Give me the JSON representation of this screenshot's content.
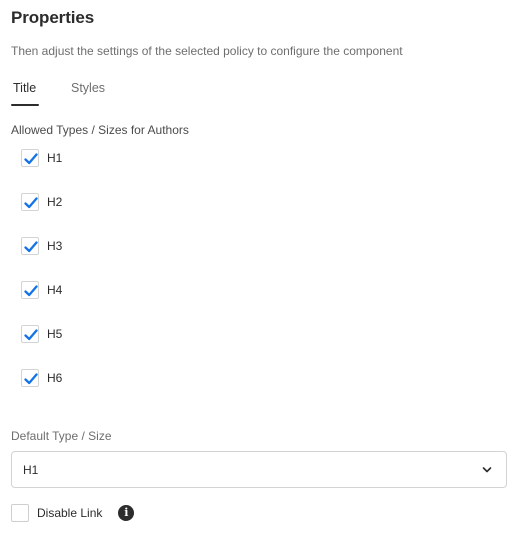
{
  "header": {
    "title": "Properties",
    "description": "Then adjust the settings of the selected policy to configure the component"
  },
  "tabs": [
    {
      "label": "Title",
      "active": true
    },
    {
      "label": "Styles",
      "active": false
    }
  ],
  "allowed_types": {
    "label": "Allowed Types / Sizes for Authors",
    "options": [
      {
        "label": "H1",
        "checked": true
      },
      {
        "label": "H2",
        "checked": true
      },
      {
        "label": "H3",
        "checked": true
      },
      {
        "label": "H4",
        "checked": true
      },
      {
        "label": "H5",
        "checked": true
      },
      {
        "label": "H6",
        "checked": true
      }
    ]
  },
  "default_type": {
    "label": "Default Type / Size",
    "value": "H1",
    "icon": "chevron-down-icon"
  },
  "disable_link": {
    "label": "Disable Link",
    "checked": false,
    "info_icon": "info-icon"
  },
  "colors": {
    "accent": "#1473e6",
    "text": "#2c2c2c",
    "muted": "#6e6e6e",
    "border": "#d3d3d3"
  }
}
